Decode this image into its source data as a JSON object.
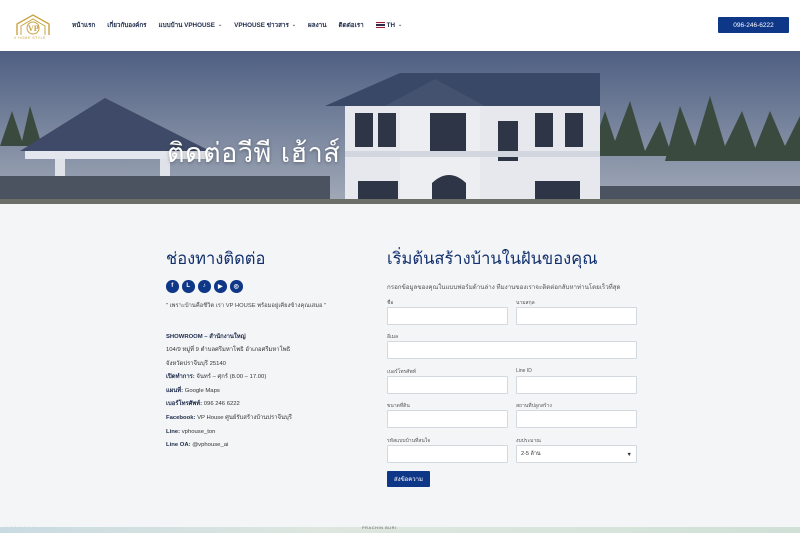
{
  "header": {
    "logo_text": "V HOME STYLE",
    "nav": [
      {
        "label": "หน้าแรก",
        "dropdown": false
      },
      {
        "label": "เกี่ยวกับองค์กร",
        "dropdown": false
      },
      {
        "label": "แบบบ้าน VPHOUSE",
        "dropdown": true
      },
      {
        "label": "VPHOUSE ข่าวสาร",
        "dropdown": true
      },
      {
        "label": "ผลงาน",
        "dropdown": false
      },
      {
        "label": "ติดต่อเรา",
        "dropdown": false
      }
    ],
    "language": "TH",
    "phone_button": "096-246-6222"
  },
  "hero": {
    "title": "ติดต่อวีพี เฮ้าส์"
  },
  "contact": {
    "heading": "ช่องทางติดต่อ",
    "socials": [
      "facebook-icon",
      "line-icon",
      "tiktok-icon",
      "youtube-icon",
      "instagram-icon"
    ],
    "quote": "\" เพราะบ้านคือชีวิต เรา VP HOUSE พร้อมอยู่เคียงข้างคุณเสมอ \"",
    "showroom_title": "SHOWROOM – สำนักงานใหญ่",
    "address_1": "104/9 หมู่ที่ 9 ตำบลศรีมหาโพธิ อำเภอศรีมหาโพธิ",
    "address_2": "จังหวัดปราจีนบุรี 25140",
    "hours_label": "เปิดทำการ:",
    "hours_value": "จันทร์ – ศุกร์ (8.00 – 17.00)",
    "map_label": "แผนที่:",
    "map_value": "Google Maps",
    "phone_label": "เบอร์โทรศัพท์:",
    "phone_value": "096 246 6222",
    "facebook_label": "Facebook:",
    "facebook_value": "VP House ศูนย์รับสร้างบ้านปราจีนบุรี",
    "line_label": "Line:",
    "line_value": "vphouse_ton",
    "lineoa_label": "Line OA:",
    "lineoa_value": "@vphouse_ai"
  },
  "form": {
    "heading": "เริ่มต้นสร้างบ้านในฝันของคุณ",
    "subtitle": "กรอกข้อมูลของคุณในแบบฟอร์มด้านล่าง ทีมงานของเราจะติดต่อกลับหาท่านโดยเร็วที่สุด",
    "fields": {
      "first_name": "ชื่อ",
      "last_name": "นามสกุล",
      "email": "อีเมล",
      "phone": "เบอร์โทรศัพท์",
      "line_id": "Line ID",
      "land_size": "ขนาดที่ดิน",
      "location": "สถานที่ปลูกสร้าง",
      "house_code": "รหัสแบบบ้านที่สนใจ",
      "budget": "งบประมาณ"
    },
    "budget_value": "2-5 ล้าน",
    "submit_label": "ส่งข้อความ"
  },
  "map_strip": {
    "label": "PRACHIN BURI"
  },
  "colors": {
    "brand_navy": "#0f3787",
    "heading_blue": "#12306e",
    "logo_gold": "#c9a443"
  }
}
